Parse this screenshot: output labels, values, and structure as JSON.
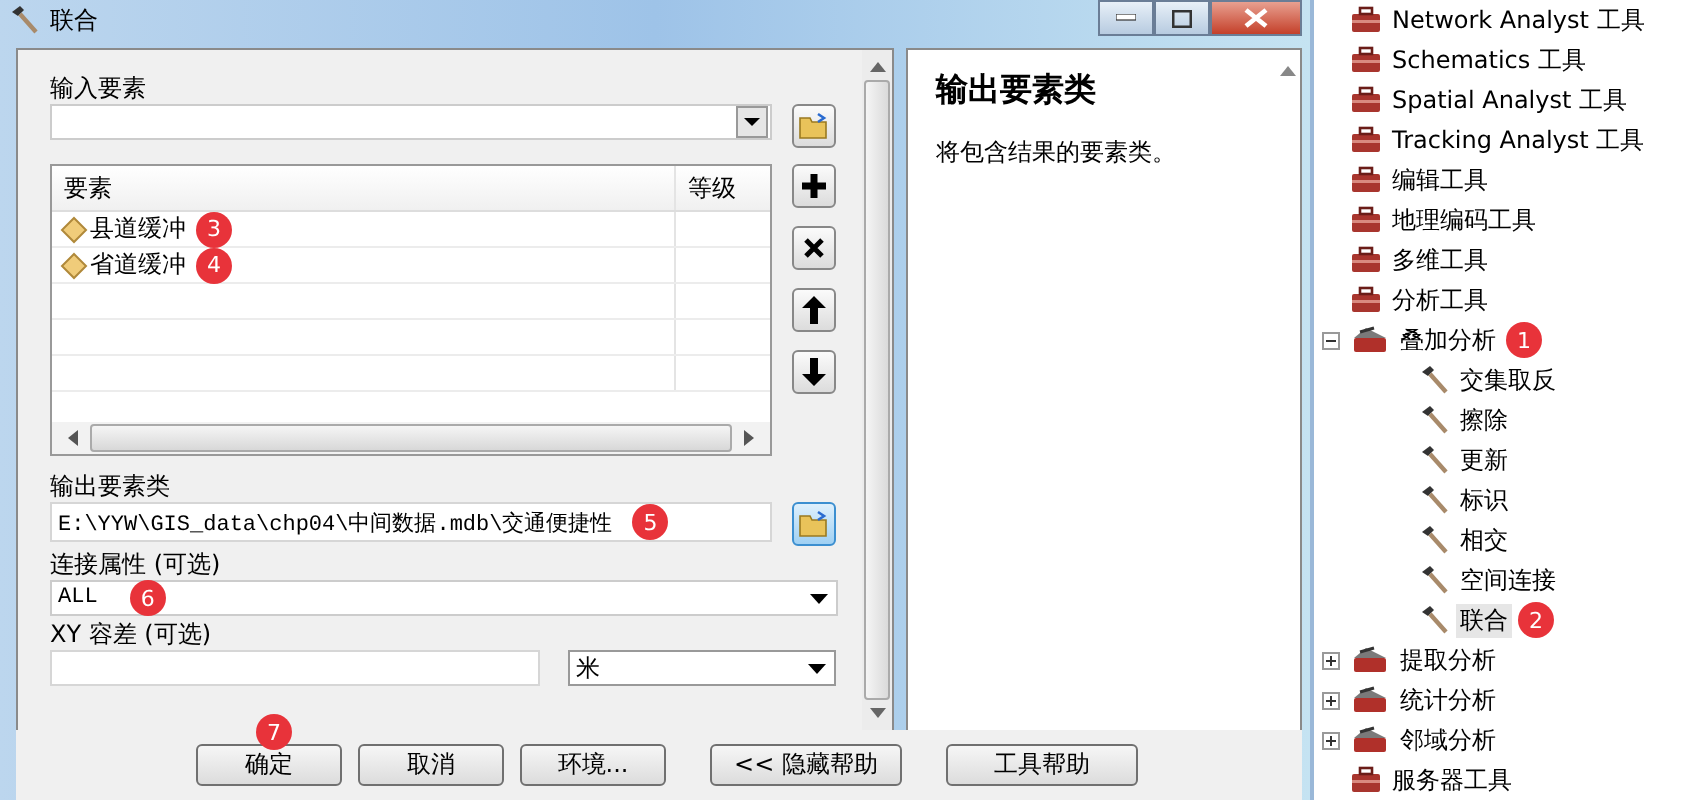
{
  "window": {
    "title": "联合"
  },
  "form": {
    "input_features": {
      "label": "输入要素"
    },
    "feature_list": {
      "columns": [
        "要素",
        "等级"
      ],
      "rows": [
        {
          "name": "县道缓冲",
          "badge": "3"
        },
        {
          "name": "省道缓冲",
          "badge": "4"
        }
      ]
    },
    "output": {
      "label": "输出要素类",
      "value": "E:\\YYW\\GIS_data\\chp04\\中间数据.mdb\\交通便捷性",
      "badge": "5"
    },
    "join_attributes": {
      "label": "连接属性 (可选)",
      "value": "ALL",
      "badge": "6"
    },
    "xy_tolerance": {
      "label": "XY 容差 (可选)",
      "unit": "米"
    }
  },
  "buttons": [
    {
      "label": "确定",
      "badge": "7"
    },
    {
      "label": "取消"
    },
    {
      "label": "环境..."
    },
    {
      "label": "<< 隐藏帮助"
    },
    {
      "label": "工具帮助"
    }
  ],
  "help": {
    "title": "输出要素类",
    "text": "将包含结果的要素类。"
  },
  "tree": [
    {
      "kind": "toolbox",
      "label": "Network Analyst 工具"
    },
    {
      "kind": "toolbox",
      "label": "Schematics 工具"
    },
    {
      "kind": "toolbox",
      "label": "Spatial Analyst 工具"
    },
    {
      "kind": "toolbox",
      "label": "Tracking Analyst 工具"
    },
    {
      "kind": "toolbox",
      "label": "编辑工具"
    },
    {
      "kind": "toolbox",
      "label": "地理编码工具"
    },
    {
      "kind": "toolbox",
      "label": "多维工具"
    },
    {
      "kind": "toolbox",
      "label": "分析工具"
    },
    {
      "kind": "toolset",
      "label": "叠加分析",
      "expanded": true,
      "badge": "1",
      "children": [
        {
          "kind": "tool",
          "label": "交集取反",
          "selected": false
        },
        {
          "kind": "tool",
          "label": "擦除",
          "selected": false
        },
        {
          "kind": "tool",
          "label": "更新",
          "selected": false
        },
        {
          "kind": "tool",
          "label": "标识",
          "selected": false
        },
        {
          "kind": "tool",
          "label": "相交",
          "selected": false
        },
        {
          "kind": "tool",
          "label": "空间连接",
          "selected": false
        },
        {
          "kind": "tool",
          "label": "联合",
          "selected": true,
          "badge": "2"
        }
      ]
    },
    {
      "kind": "toolset",
      "label": "提取分析",
      "expanded": false
    },
    {
      "kind": "toolset",
      "label": "统计分析",
      "expanded": false
    },
    {
      "kind": "toolset",
      "label": "邻域分析",
      "expanded": false
    },
    {
      "kind": "toolbox",
      "label": "服务器工具"
    }
  ]
}
